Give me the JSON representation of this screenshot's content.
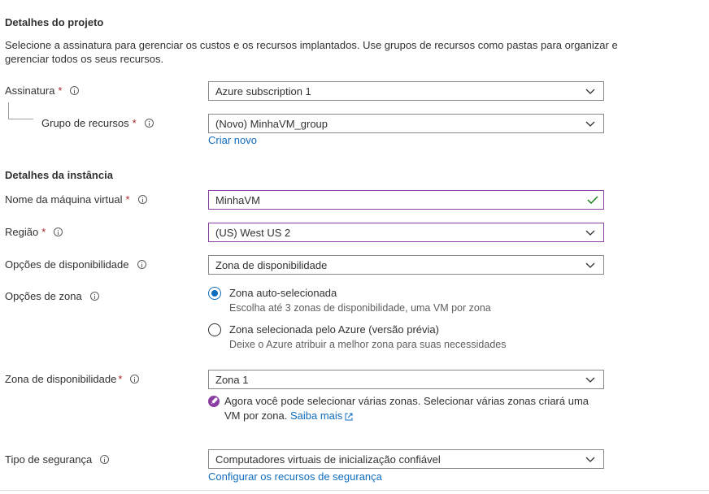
{
  "project": {
    "title": "Detalhes do projeto",
    "description": "Selecione a assinatura para gerenciar os custos e os recursos implantados. Use grupos de recursos como pastas para organizar e gerenciar todos os seus recursos.",
    "subscription": {
      "label": "Assinatura",
      "required": "*",
      "value": "Azure subscription 1"
    },
    "resource_group": {
      "label": "Grupo de recursos",
      "required": "*",
      "value": "(Novo) MinhaVM_group",
      "create_link": "Criar novo"
    }
  },
  "instance": {
    "title": "Detalhes da instância",
    "vm_name": {
      "label": "Nome da máquina virtual",
      "required": "*",
      "value": "MinhaVM"
    },
    "region": {
      "label": "Região",
      "required": "*",
      "value": "(US) West US 2"
    },
    "availability_options": {
      "label": "Opções de disponibilidade",
      "value": "Zona de disponibilidade"
    },
    "zone_options": {
      "label": "Opções de zona",
      "options": [
        {
          "title": "Zona auto-selecionada",
          "subtitle": "Escolha até 3 zonas de disponibilidade, uma VM por zona",
          "selected": true
        },
        {
          "title": "Zona selecionada pelo Azure (versão prévia)",
          "subtitle": "Deixe o Azure atribuir a melhor zona para suas necessidades",
          "selected": false
        }
      ]
    },
    "availability_zone": {
      "label": "Zona de disponibilidade",
      "required": "*",
      "value": "Zona 1",
      "notice": "Agora você pode selecionar várias zonas. Selecionar várias zonas criará uma VM por zona.",
      "notice_link": "Saiba mais"
    },
    "security_type": {
      "label": "Tipo de segurança",
      "value": "Computadores virtuais de inicialização confiável",
      "config_link": "Configurar os recursos de segurança"
    }
  },
  "colors": {
    "accent": "#0f6cbd",
    "required": "#a4262c",
    "focus_border": "#8a3ea1",
    "valid_check": "#107c10"
  },
  "icons": {
    "info": "info-icon",
    "dropdown": "chevron-down-icon",
    "valid": "checkmark-icon",
    "notice": "rocket-icon",
    "external": "external-link-icon"
  }
}
